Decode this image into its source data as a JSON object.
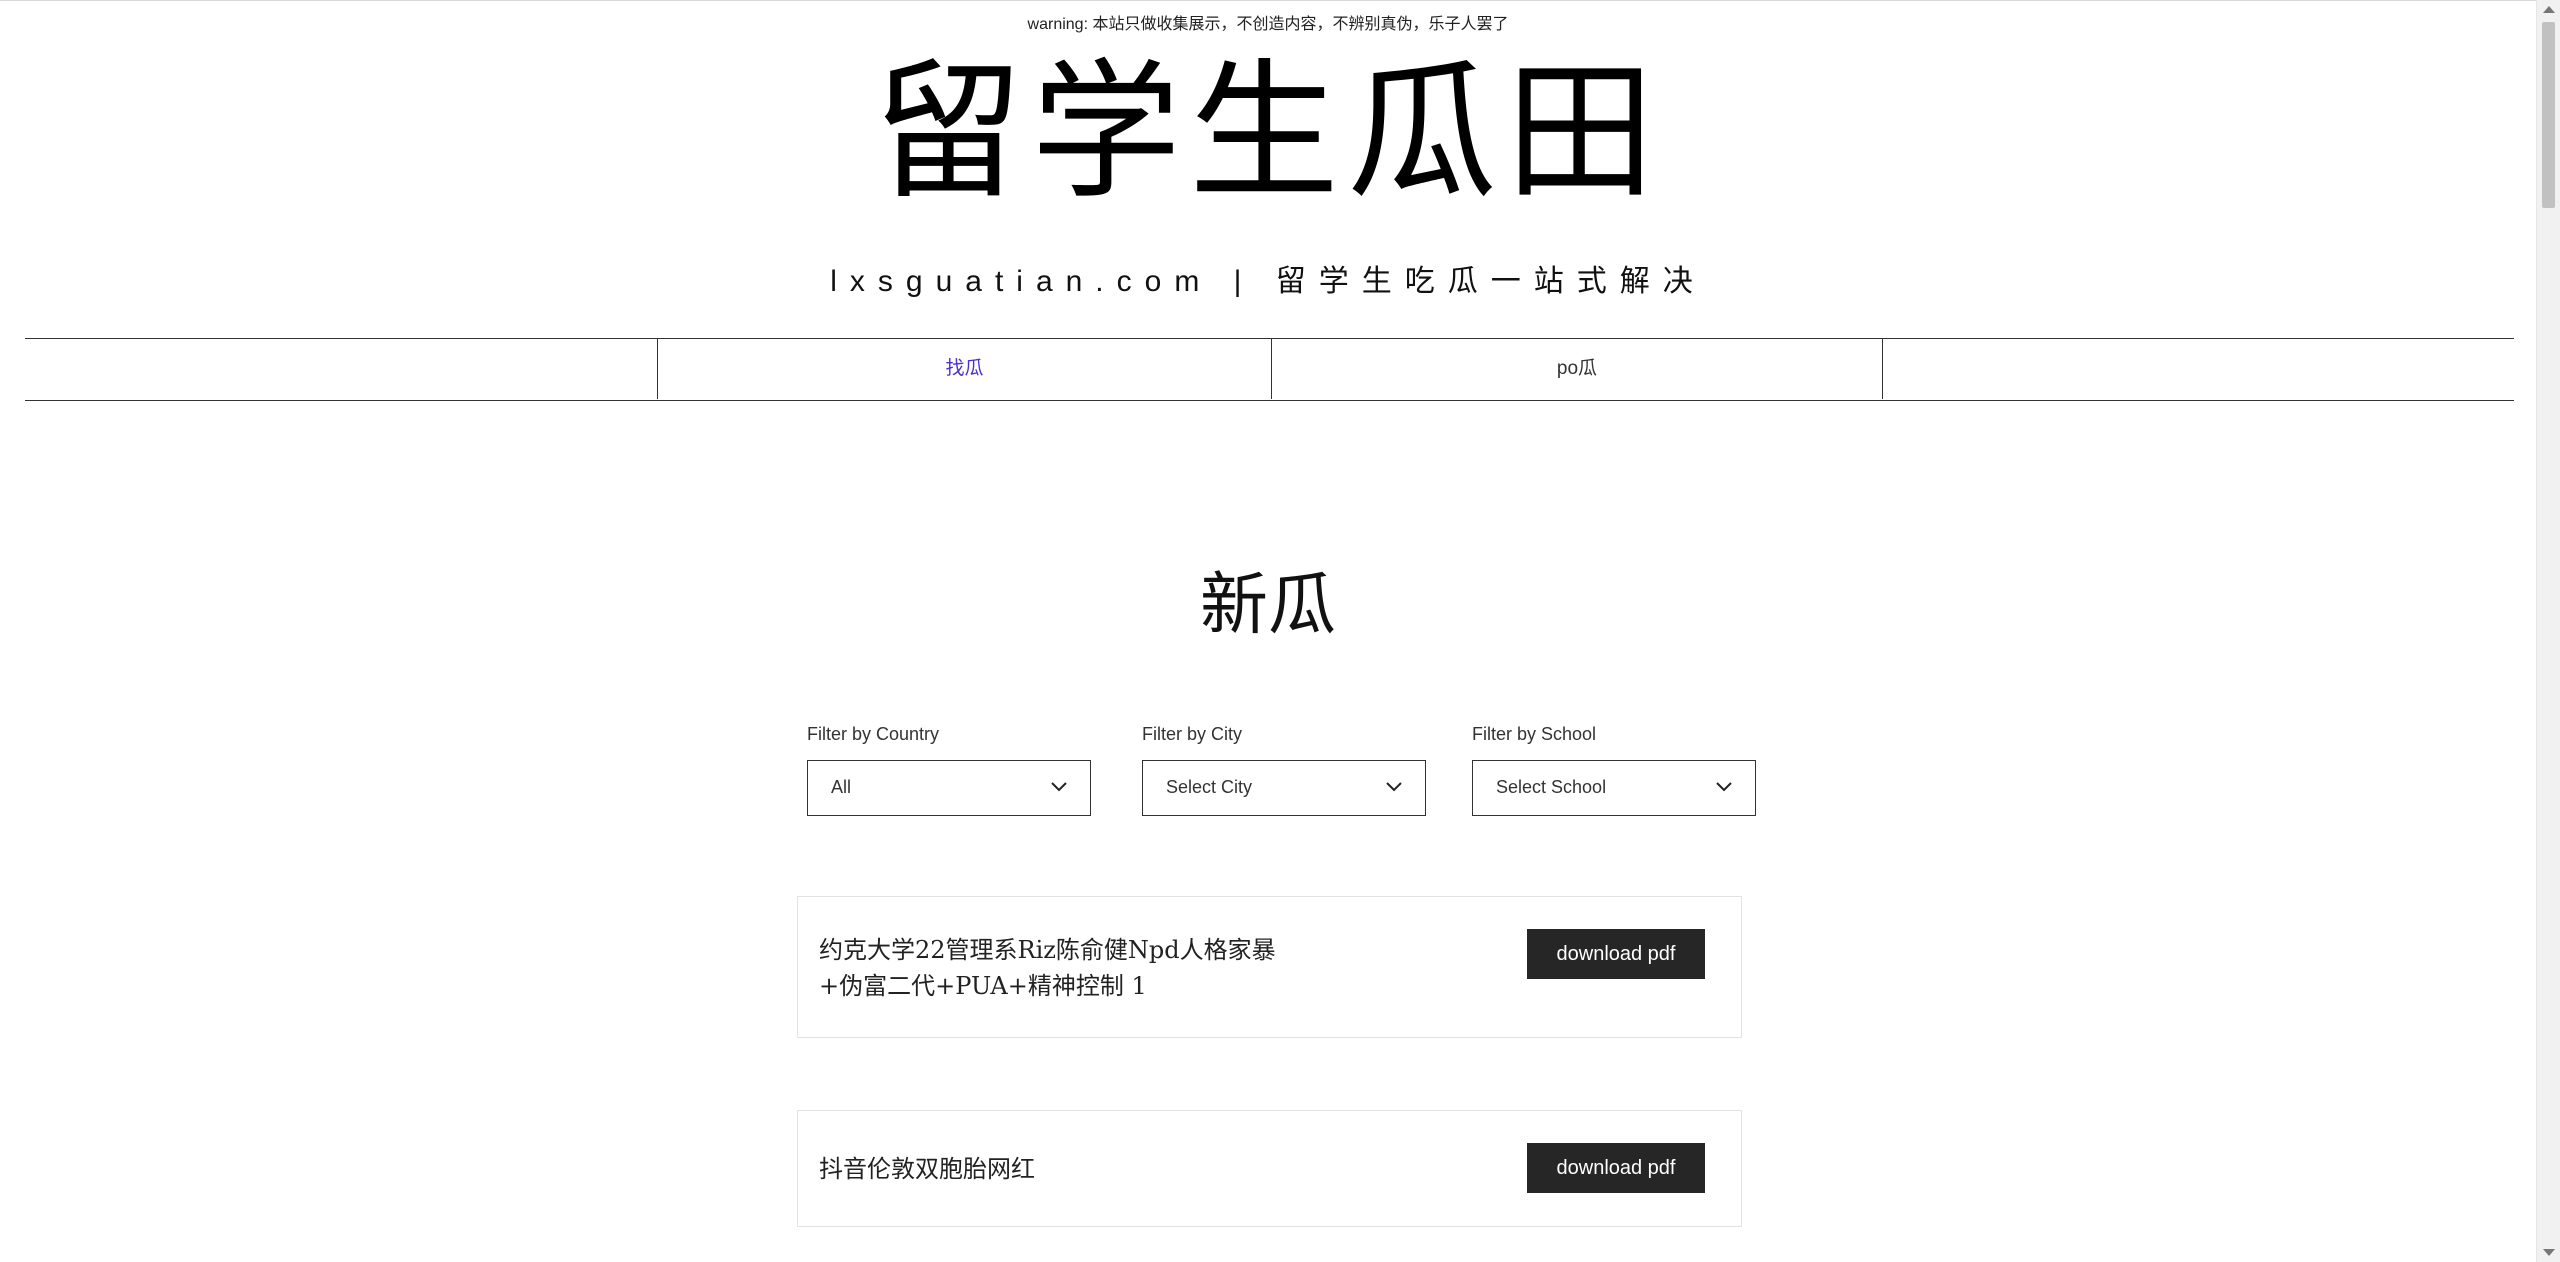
{
  "header": {
    "warning": "warning: 本站只做收集展示，不创造内容，不辨别真伪，乐子人罢了",
    "title": "留学生瓜田",
    "tagline": "lxsguatian.com | 留学生吃瓜一站式解决"
  },
  "nav": {
    "items": [
      {
        "label": "找瓜",
        "active": true
      },
      {
        "label": "po瓜",
        "active": false
      }
    ],
    "active_color": "#4a2fd1"
  },
  "main": {
    "section_title": "新瓜",
    "filters": [
      {
        "label": "Filter by Country",
        "value": "All"
      },
      {
        "label": "Filter by City",
        "value": "Select City"
      },
      {
        "label": "Filter by School",
        "value": "Select School"
      }
    ],
    "posts": [
      {
        "title": "约克大学22管理系Riz陈俞健Npd人格家暴+伪富二代+PUA+精神控制 1",
        "button": "download pdf"
      },
      {
        "title": "抖音伦敦双胞胎网红",
        "button": "download pdf"
      }
    ]
  },
  "icons": {
    "chevron": "chevron-down-icon"
  },
  "colors": {
    "button_bg": "#262626",
    "border": "#333333"
  }
}
